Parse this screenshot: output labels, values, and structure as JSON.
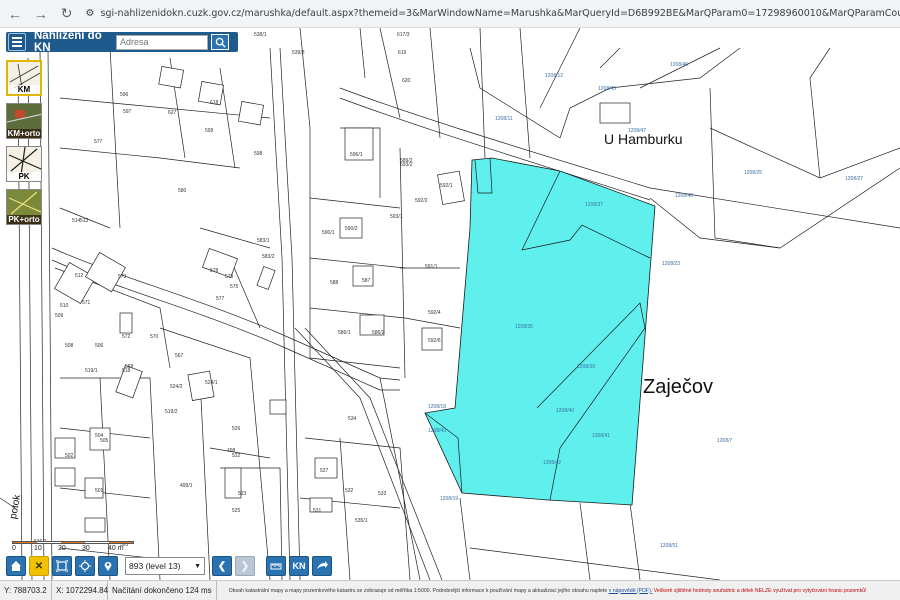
{
  "browser": {
    "url": "sgi-nahlizenidokn.cuzk.gov.cz/marushka/default.aspx?themeid=3&MarWindowName=Marushka&MarQueryId=D6B992BE&MarQParam0=17298960010&MarQParamCount=1"
  },
  "app": {
    "title": "Nahlížení do KN",
    "search_placeholder": "Adresa"
  },
  "layers": [
    {
      "label": "KM",
      "active": true
    },
    {
      "label": "KM+orto",
      "active": false
    },
    {
      "label": "PK",
      "active": false
    },
    {
      "label": "PK+orto",
      "active": false
    }
  ],
  "scale": {
    "ticks": [
      "0",
      "10",
      "20",
      "30",
      "40 m"
    ]
  },
  "toolbar": {
    "level_value": "893 (level 13)",
    "kn_label": "KN"
  },
  "map": {
    "place_label": "Zaječov",
    "locality_label": "U Hamburku",
    "stream_label": "potok",
    "highlight_color": "#5ff0ee",
    "parcels": [
      "1208/37",
      "1208/35",
      "1208/39",
      "1208/40",
      "1208/41",
      "1208/42",
      "1208/43",
      "1208/23",
      "1208/18",
      "1208/19",
      "1208/25",
      "1208/27",
      "1208/48",
      "1208/47",
      "1208/46",
      "1208/45",
      "1208/12",
      "1208/11",
      "1208/7",
      "1208/51",
      "596/1",
      "593/1",
      "593/2",
      "589/2",
      "592/2",
      "592/1",
      "591/1",
      "590/1",
      "590/2",
      "588",
      "587",
      "586/1",
      "586/2",
      "592/4",
      "592/6",
      "580",
      "577",
      "583/1",
      "583/2",
      "578",
      "579",
      "575",
      "577",
      "573",
      "571",
      "572",
      "570",
      "568",
      "567",
      "524/1",
      "524/2",
      "519/2",
      "519/1",
      "518",
      "514",
      "513",
      "512",
      "510",
      "509",
      "508",
      "506",
      "505",
      "504",
      "502",
      "501",
      "499/1",
      "498",
      "522",
      "523",
      "525",
      "526",
      "527",
      "531",
      "532",
      "533",
      "535/1",
      "534",
      "536/2",
      "538/1",
      "539/3",
      "617/3",
      "619",
      "620",
      "627",
      "618",
      "599",
      "598",
      "597",
      "596",
      "595",
      "601",
      "600",
      "495"
    ]
  },
  "status": {
    "y_coord": "Y: 788703.2",
    "x_coord": "X: 1072294.84",
    "load_msg": "Načítání dokončeno 124 ms",
    "info_text": "Obsah katastrální mapy a mapy pozemkového katastru se zobrazuje od měřítka 1:5000. Podrobnější informace k používání mapy a aktualizaci jejího obsahu naplete",
    "info_link": "v nápovědě (PDF).",
    "info_warn": "Veškeré zjištěné hodnoty souřadnic a délek NELZE využívat pro vytyčování hranic pozemků!"
  }
}
